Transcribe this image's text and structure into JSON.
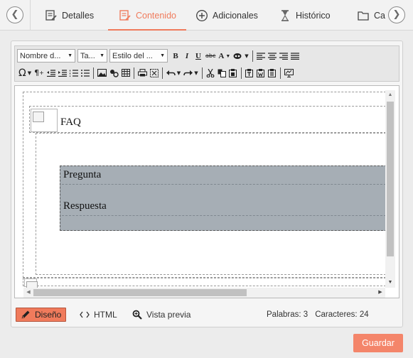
{
  "tabs": [
    {
      "label": "Detalles",
      "icon": "details-icon",
      "active": false
    },
    {
      "label": "Contenido",
      "icon": "content-icon",
      "active": true
    },
    {
      "label": "Adicionales",
      "icon": "add-circle-icon",
      "active": false
    },
    {
      "label": "Histórico",
      "icon": "hourglass-icon",
      "active": false
    },
    {
      "label": "Car",
      "icon": "folder-icon",
      "active": false
    }
  ],
  "nav": {
    "prev_icon": "chevron-left-icon",
    "next_icon": "chevron-right-icon"
  },
  "toolbar": {
    "font_name": "Nombre d...",
    "font_size": "Ta...",
    "style": "Estilo del ...",
    "row1_buttons": [
      "bold",
      "italic",
      "underline",
      "strikethrough",
      "text-color",
      "highlight",
      "align-left",
      "align-center",
      "align-right",
      "justify"
    ],
    "row2_buttons": [
      "special-char",
      "paragraph-mark",
      "outdent",
      "indent",
      "ordered-list",
      "unordered-list",
      "image",
      "media",
      "table",
      "print",
      "fullscreen",
      "undo",
      "redo",
      "cut",
      "copy",
      "paste",
      "paste-text",
      "paste-word",
      "paste-plain",
      "preview"
    ],
    "labels": {
      "bold": "B",
      "italic": "I",
      "underline": "U",
      "strike": "abc",
      "text_color": "A",
      "omega": "Ω",
      "pilcrow": "¶"
    }
  },
  "editor": {
    "faq_text": "FAQ",
    "question": "Pregunta",
    "answer": "Respuesta"
  },
  "modes": {
    "design": "Diseño",
    "html": "HTML",
    "preview": "Vista previa"
  },
  "stats": {
    "words": "Palabras: 3",
    "chars": "Caracteres: 24"
  },
  "save_label": "Guardar",
  "colors": {
    "accent": "#f07b5c",
    "save": "#f4856a",
    "qa_background": "#a6aeb5"
  }
}
